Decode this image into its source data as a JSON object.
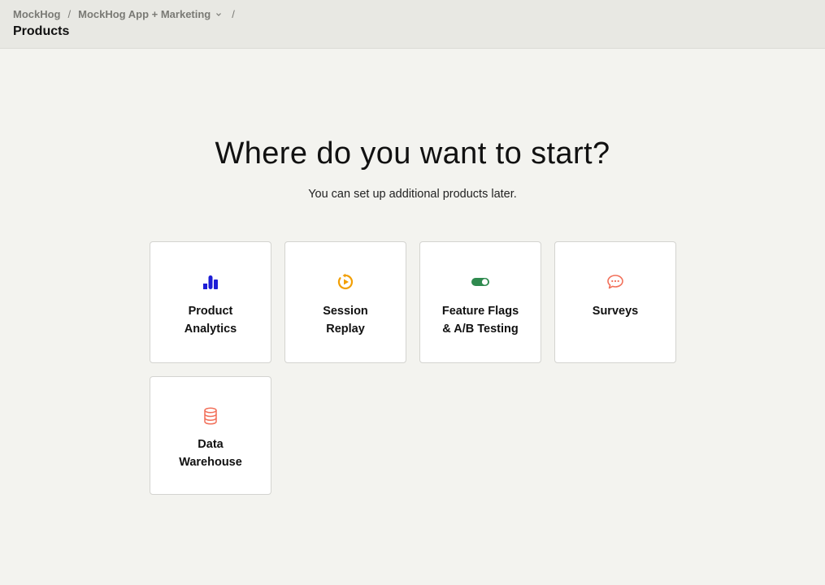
{
  "breadcrumb": {
    "org": "MockHog",
    "project": "MockHog App + Marketing",
    "separator": "/"
  },
  "page": {
    "title": "Products",
    "heading": "Where do you want to start?",
    "subheading": "You can set up additional products later."
  },
  "products": [
    {
      "label": "Product\nAnalytics",
      "icon": "bar-chart-icon",
      "color": "#1d1dd6"
    },
    {
      "label": "Session\nReplay",
      "icon": "replay-icon",
      "color": "#f29f05"
    },
    {
      "label": "Feature Flags\n& A/B Testing",
      "icon": "toggle-icon",
      "color": "#2f8a4f"
    },
    {
      "label": "Surveys",
      "icon": "chat-bubble-icon",
      "color": "#f2705a"
    },
    {
      "label": "Data\nWarehouse",
      "icon": "database-icon",
      "color": "#f2705a"
    }
  ]
}
